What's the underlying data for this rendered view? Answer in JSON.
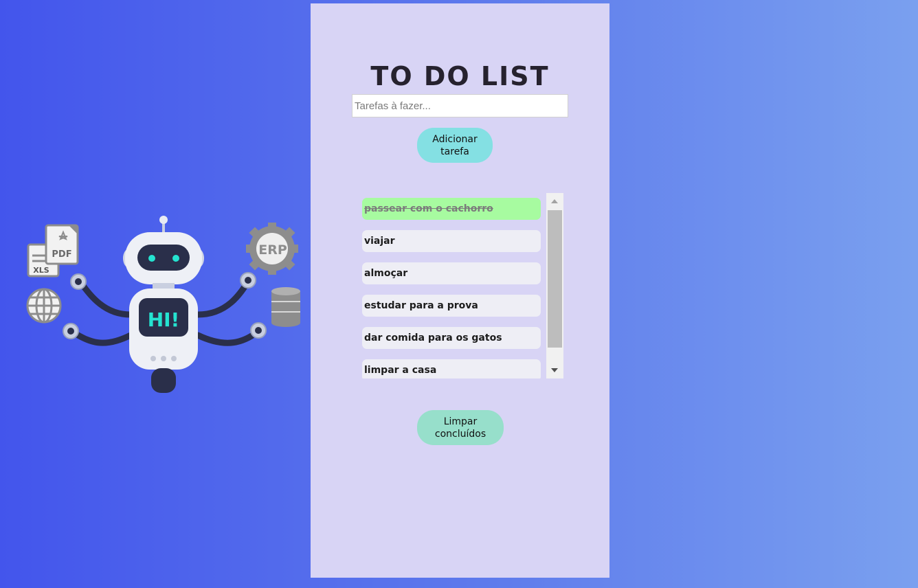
{
  "app": {
    "title": "TO DO LIST"
  },
  "form": {
    "placeholder": "Tarefas à fazer...",
    "value": "",
    "add_label": "Adicionar tarefa"
  },
  "tasks": [
    {
      "label": "passear com o cachorro",
      "done": true
    },
    {
      "label": "viajar",
      "done": false
    },
    {
      "label": "almoçar",
      "done": false
    },
    {
      "label": "estudar para a prova",
      "done": false
    },
    {
      "label": "dar comida para os gatos",
      "done": false
    },
    {
      "label": "limpar a casa",
      "done": false
    }
  ],
  "footer": {
    "clear_label": "Limpar concluídos"
  },
  "illustration": {
    "screen_text": "HI!",
    "badge_pdf": "PDF",
    "badge_xls": "XLS",
    "badge_erp": "ERP"
  },
  "colors": {
    "panel": "#d8d4f5",
    "done_item": "#a7fba0",
    "add_button": "#84e0e3",
    "clear_button": "#97dfcb"
  }
}
